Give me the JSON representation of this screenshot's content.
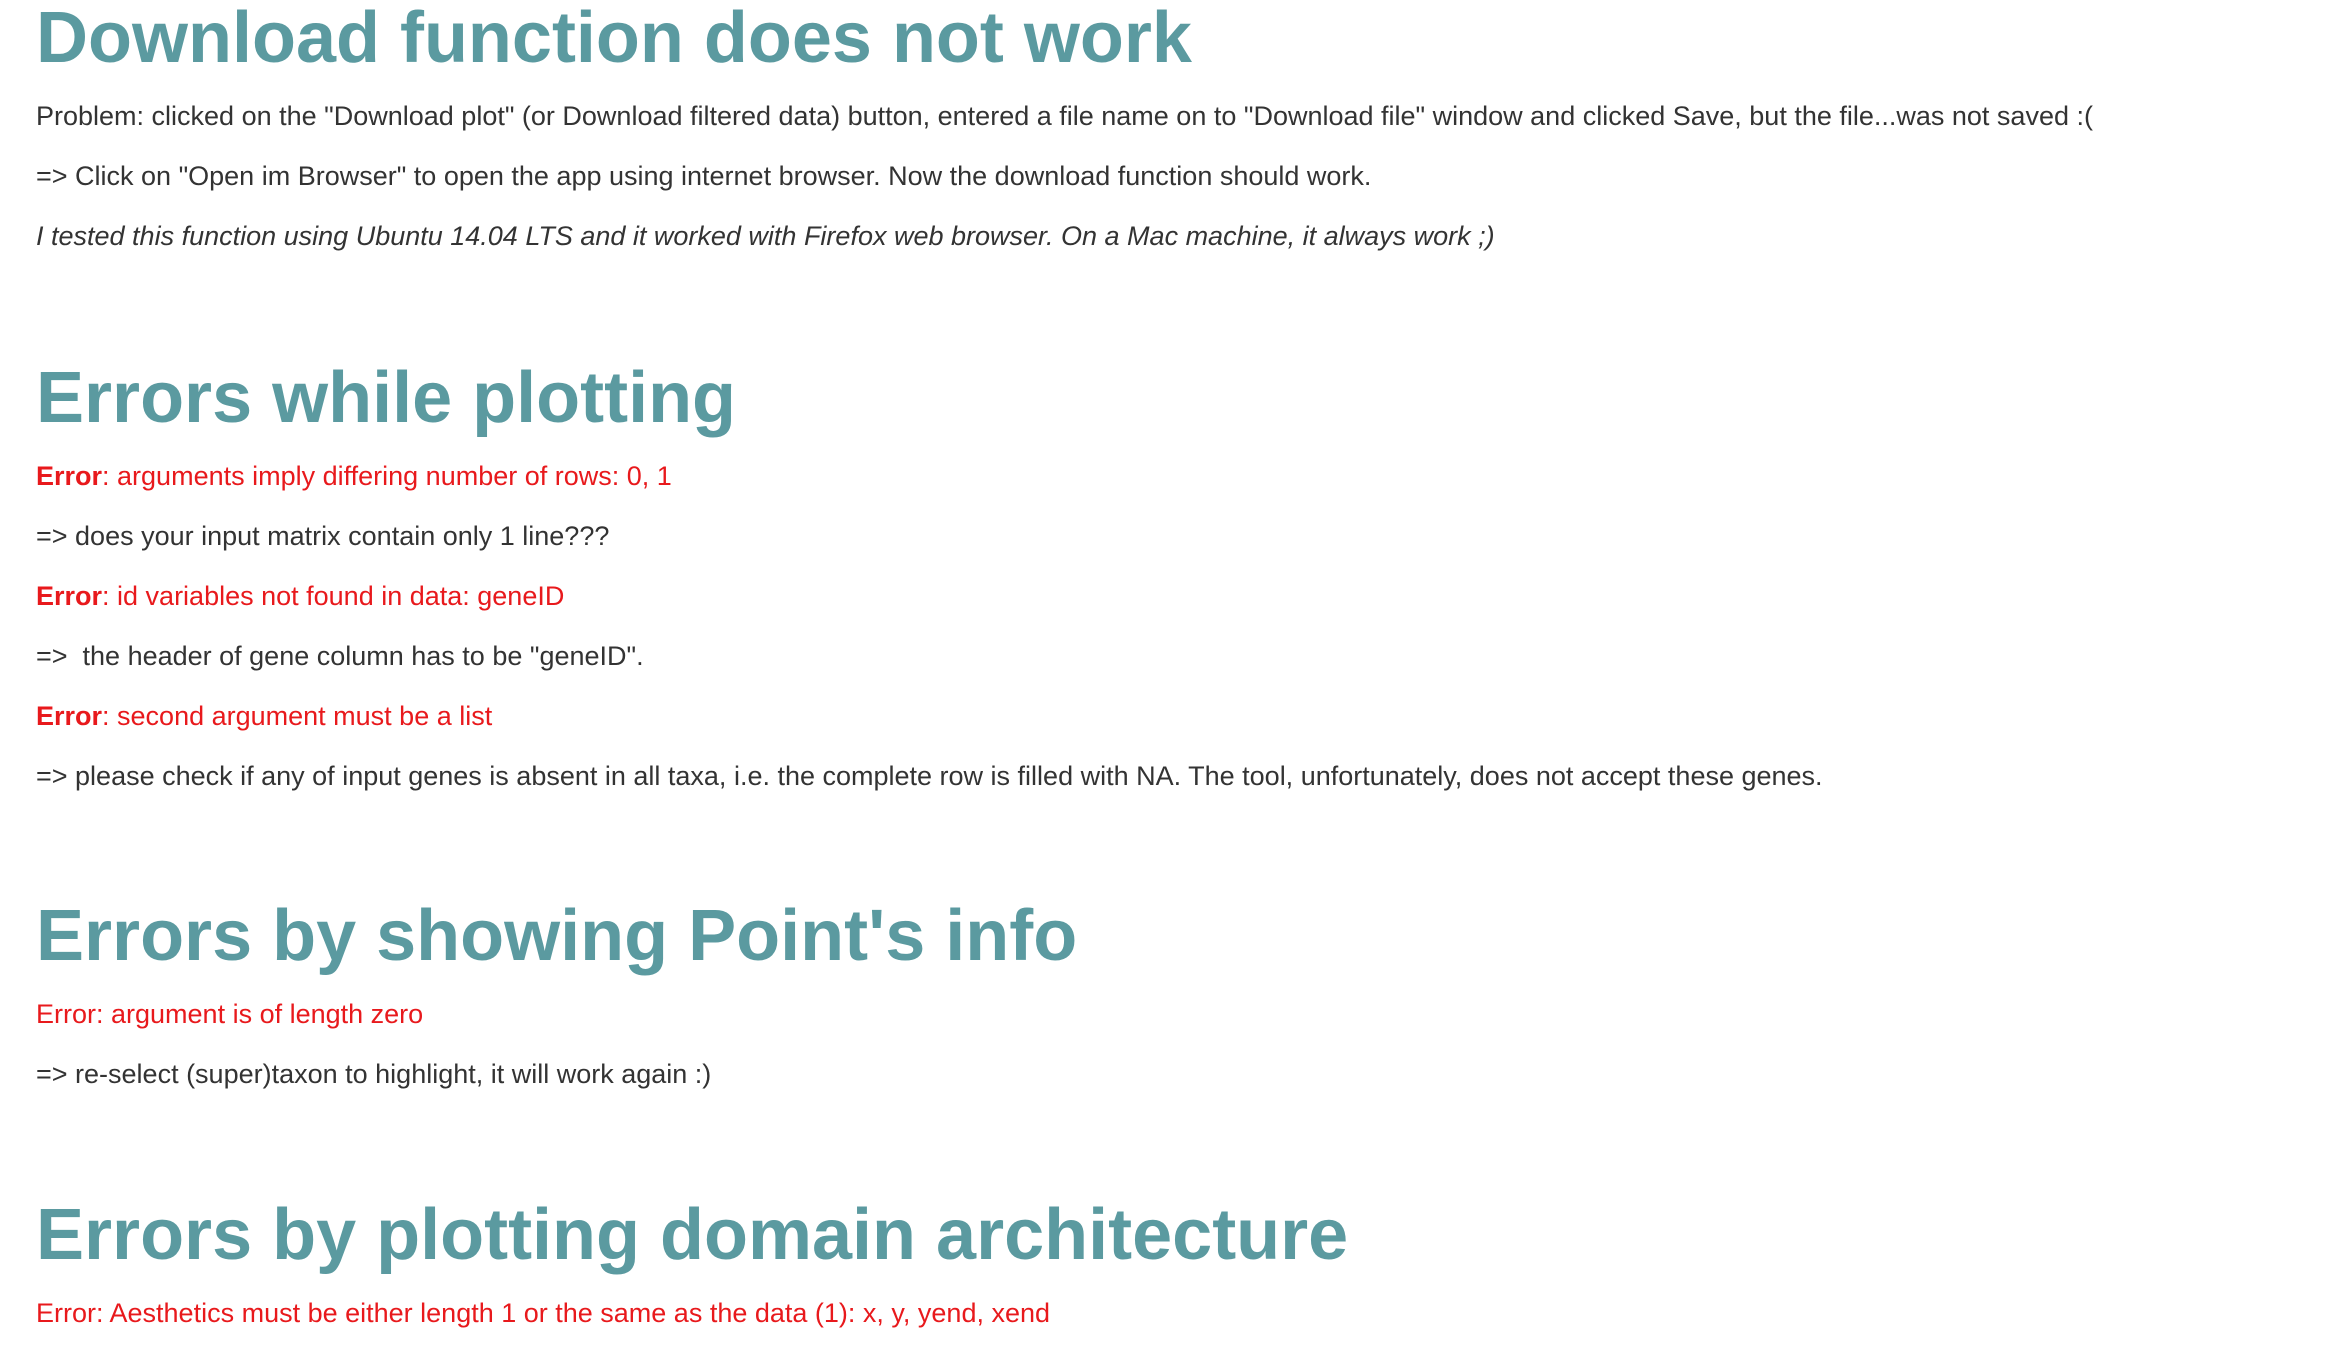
{
  "sections": [
    {
      "heading": "Download function does not work",
      "lines": [
        "Problem: clicked on the \"Download plot\" (or Download filtered data) button, entered a file name on to \"Download file\" window and clicked Save, but the file...was not saved :(",
        "=> Click on \"Open im Browser\" to open the app using internet browser. Now the download function should work.",
        "I tested this function using Ubuntu 14.04 LTS and it worked with Firefox web browser. On a Mac machine, it always work ;)"
      ]
    },
    {
      "heading": "Errors while plotting",
      "items": [
        {
          "error_label": "Error",
          "error_text": ": arguments imply differing number of rows: 0, 1",
          "solution": "=> does your input matrix contain only 1 line???"
        },
        {
          "error_label": "Error",
          "error_text": ": id variables not found in data: geneID",
          "solution": "=>  the header of gene column has to be \"geneID\"."
        },
        {
          "error_label": "Error",
          "error_text": ": second argument must be a list",
          "solution": "=> please check if any of input genes is absent in all taxa, i.e. the complete row is filled with NA. The tool, unfortunately, does not accept these genes."
        }
      ]
    },
    {
      "heading": "Errors by showing Point's info",
      "error": "Error: argument is of length zero",
      "solution": "=> re-select (super)taxon to highlight, it will work again :)"
    },
    {
      "heading": "Errors by plotting domain architecture",
      "error": "Error: Aesthetics must be either length 1 or the same as the data (1): x, y, yend, xend"
    }
  ],
  "colors": {
    "heading": "#5b9aa0",
    "error": "#e8191c",
    "body_text": "#333333"
  }
}
